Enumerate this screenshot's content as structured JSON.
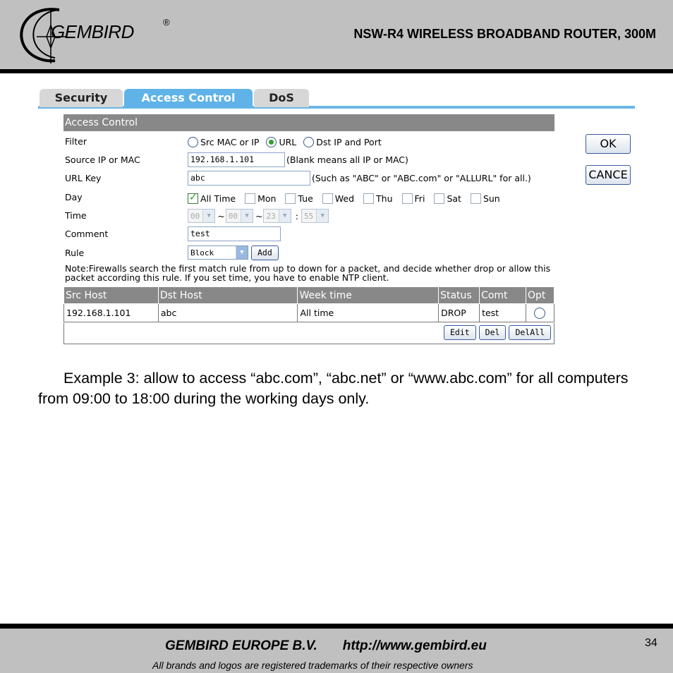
{
  "header": {
    "brand": "GEMBIRD",
    "reg_mark": "®",
    "doc_title": "NSW-R4 WIRELESS BROADBAND ROUTER, 300M"
  },
  "tabs": [
    {
      "label": "Security",
      "active": false
    },
    {
      "label": "Access Control",
      "active": true
    },
    {
      "label": "DoS",
      "active": false
    }
  ],
  "panel": {
    "title": "Access Control",
    "filter": {
      "label": "Filter",
      "options": [
        "Src MAC or IP",
        "URL",
        "Dst IP and Port"
      ],
      "selected": "URL"
    },
    "source": {
      "label": "Source IP or MAC",
      "value": "192.168.1.101",
      "hint": "(Blank means all IP or MAC)"
    },
    "url_key": {
      "label": "URL Key",
      "value": "abc",
      "hint": "(Such as \"ABC\" or \"ABC.com\" or \"ALLURL\" for all.)"
    },
    "day": {
      "label": "Day",
      "options": [
        "All Time",
        "Mon",
        "Tue",
        "Wed",
        "Thu",
        "Fri",
        "Sat",
        "Sun"
      ],
      "checked": [
        "All Time"
      ]
    },
    "time": {
      "label": "Time",
      "start_hour": "00",
      "start_min": "00",
      "end_hour": "23",
      "end_min": "55",
      "sep_range": "~",
      "sep_colon": ":"
    },
    "comment": {
      "label": "Comment",
      "value": "test"
    },
    "rule": {
      "label": "Rule",
      "value": "Block",
      "add_label": "Add"
    },
    "note": "Note:Firewalls search the first match rule from up to down for a packet, and decide whether drop or allow this packet according this rule. If you set time, you have to enable NTP client.",
    "table": {
      "headers": [
        "Src Host",
        "Dst Host",
        "Week time",
        "Status",
        "Comt",
        "Opt"
      ],
      "rows": [
        {
          "src": "192.168.1.101",
          "dst": "abc",
          "week": "All time",
          "status": "DROP",
          "comt": "test"
        }
      ],
      "buttons": {
        "edit": "Edit",
        "del": "Del",
        "delall": "DelAll"
      }
    },
    "ok_label": "OK",
    "cancel_label": "CANCE"
  },
  "body_text": "Example 3: allow to access “abc.com”, “abc.net” or “www.abc.com” for all computers from 09:00 to 18:00 during the working days only.",
  "footer": {
    "company": "GEMBIRD EUROPE B.V.",
    "url": "http://www.gembird.eu",
    "disclaimer": "All brands and logos are registered trademarks of their respective owners",
    "page_number": "34"
  }
}
